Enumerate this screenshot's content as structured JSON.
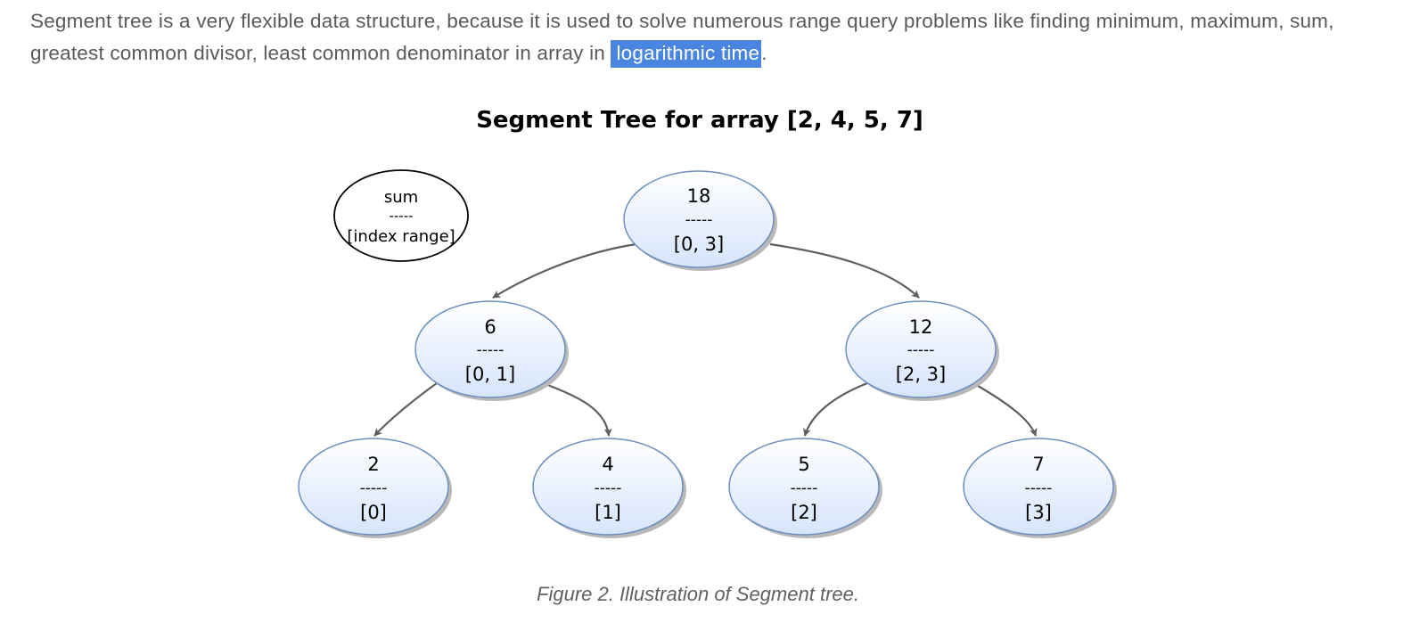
{
  "intro": {
    "text_before": "Segment tree is a very flexible data structure, because it is used to solve numerous range query problems like finding minimum, maximum, sum, greatest common divisor, least common denominator in array in ",
    "highlighted": "logarithmic time",
    "text_after": "."
  },
  "figure": {
    "title": "Segment Tree for array [2, 4, 5, 7]",
    "legend": {
      "top": "sum",
      "separator": "-----",
      "bottom": "[index range]"
    },
    "nodes": [
      {
        "id": "root",
        "value": "18",
        "separator": "-----",
        "range": "[0, 3]"
      },
      {
        "id": "left",
        "value": "6",
        "separator": "-----",
        "range": "[0, 1]"
      },
      {
        "id": "right",
        "value": "12",
        "separator": "-----",
        "range": "[2, 3]"
      },
      {
        "id": "leaf0",
        "value": "2",
        "separator": "-----",
        "range": "[0]"
      },
      {
        "id": "leaf1",
        "value": "4",
        "separator": "-----",
        "range": "[1]"
      },
      {
        "id": "leaf2",
        "value": "5",
        "separator": "-----",
        "range": "[2]"
      },
      {
        "id": "leaf3",
        "value": "7",
        "separator": "-----",
        "range": "[3]"
      }
    ],
    "edges": [
      {
        "from": "root",
        "to": "left"
      },
      {
        "from": "root",
        "to": "right"
      },
      {
        "from": "left",
        "to": "leaf0"
      },
      {
        "from": "left",
        "to": "leaf1"
      },
      {
        "from": "right",
        "to": "leaf2"
      },
      {
        "from": "right",
        "to": "leaf3"
      }
    ],
    "colors": {
      "node_fill_top": "#ffffff",
      "node_fill_bottom": "#d6e4fb",
      "node_stroke": "#6c8ebf",
      "edge": "#5f5f5f",
      "legend_stroke": "#000000"
    },
    "caption": "Figure 2. Illustration of Segment tree."
  }
}
